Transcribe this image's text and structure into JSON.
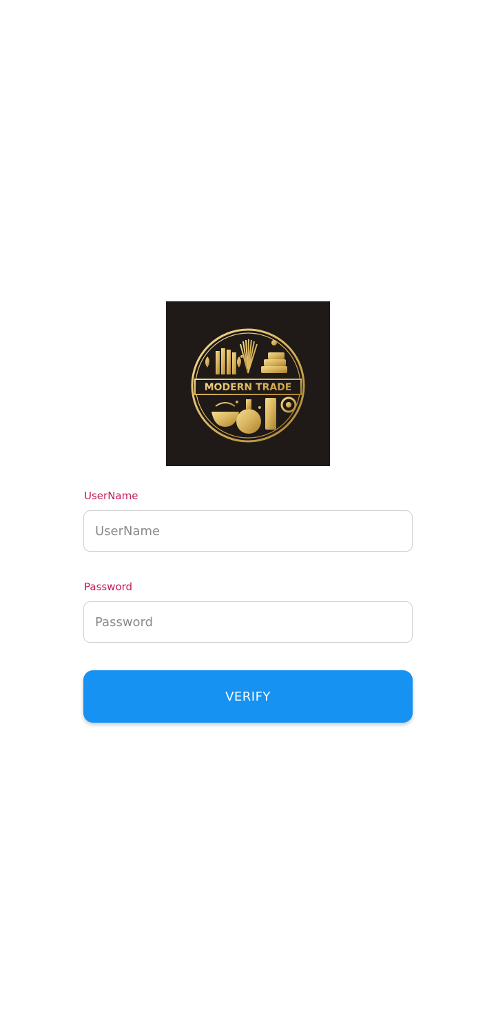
{
  "logo": {
    "text": "MODERN TRADE",
    "icon": "modern-trade-logo",
    "background": "#1f1a17",
    "gold": "#d9b35c"
  },
  "form": {
    "username": {
      "label": "UserName",
      "placeholder": "UserName",
      "value": ""
    },
    "password": {
      "label": "Password",
      "placeholder": "Password",
      "value": ""
    },
    "verify_label": "VERIFY"
  },
  "colors": {
    "label": "#c2185b",
    "button": "#1592f2",
    "input_border": "#cfcfcf"
  }
}
